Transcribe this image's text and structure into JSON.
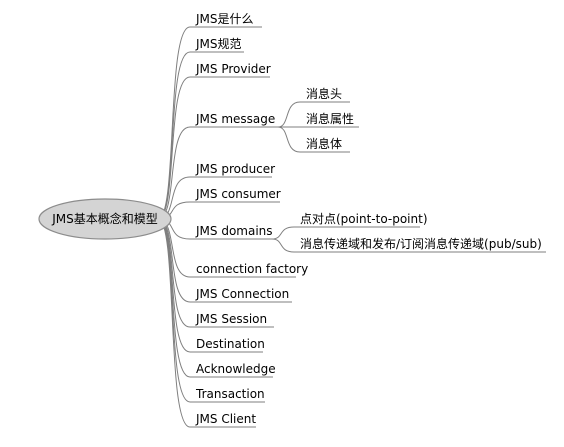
{
  "root": {
    "label": "JMS基本概念和模型"
  },
  "branches": [
    {
      "label": "JMS是什么",
      "children": []
    },
    {
      "label": "JMS规范",
      "children": []
    },
    {
      "label": "JMS Provider",
      "children": []
    },
    {
      "label": "JMS message",
      "children": [
        {
          "label": "消息头"
        },
        {
          "label": "消息属性"
        },
        {
          "label": "消息体"
        }
      ]
    },
    {
      "label": "JMS producer",
      "children": []
    },
    {
      "label": "JMS consumer",
      "children": []
    },
    {
      "label": "JMS domains",
      "children": [
        {
          "label": "点对点(point-to-point)"
        },
        {
          "label": "消息传递域和发布/订阅消息传递域(pub/sub)"
        }
      ]
    },
    {
      "label": "connection factory",
      "children": []
    },
    {
      "label": "JMS Connection",
      "children": []
    },
    {
      "label": "JMS Session",
      "children": []
    },
    {
      "label": "Destination",
      "children": []
    },
    {
      "label": "Acknowledge",
      "children": []
    },
    {
      "label": "Transaction",
      "children": []
    },
    {
      "label": "JMS Client",
      "children": []
    }
  ],
  "colors": {
    "connector": "#7f7f7f",
    "root_fill": "#d4d4d4",
    "root_stroke": "#8c8c8c",
    "text": "#000000"
  }
}
